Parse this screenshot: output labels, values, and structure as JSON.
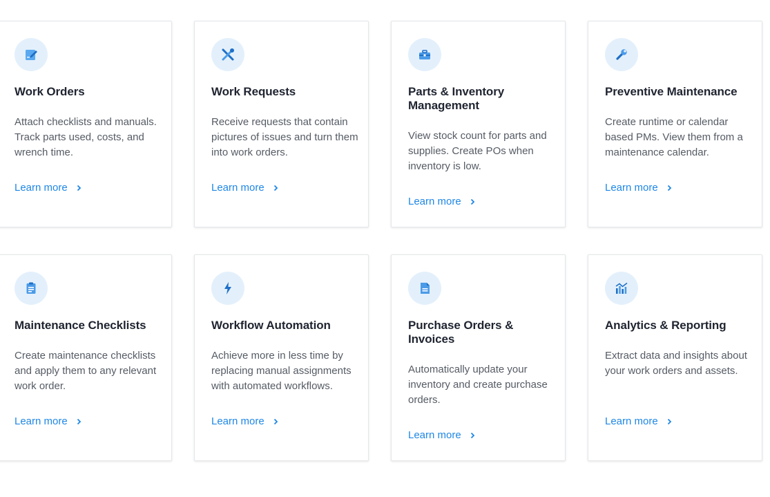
{
  "accent_color": "#1e87e6",
  "icon_bg_color": "#e3f0fc",
  "cards": [
    {
      "title": "Work Orders",
      "icon": "work-order-edit-icon",
      "description": "Attach checklists and manuals. Track parts used, costs, and wrench time.",
      "link": "Learn more"
    },
    {
      "title": "Work Requests",
      "icon": "tools-icon",
      "description": "Receive requests that contain pictures of issues and turn them into work orders.",
      "link": "Learn more"
    },
    {
      "title": "Parts & Inventory Management",
      "icon": "toolbox-icon",
      "description": "View stock count for parts and supplies. Create POs when inventory is low.",
      "link": "Learn more"
    },
    {
      "title": "Preventive Maintenance",
      "icon": "wrench-icon",
      "description": "Create runtime or calendar based PMs. View them from a maintenance calendar.",
      "link": "Learn more"
    },
    {
      "title": "Maintenance Checklists",
      "icon": "clipboard-icon",
      "description": "Create maintenance checklists and apply them to any relevant work order.",
      "link": "Learn more"
    },
    {
      "title": "Workflow Automation",
      "icon": "lightning-icon",
      "description": "Achieve more in less time by replacing manual assignments with automated workflows.",
      "link": "Learn more"
    },
    {
      "title": "Purchase Orders & Invoices",
      "icon": "document-icon",
      "description": "Automatically update your inventory and create purchase orders.",
      "link": "Learn more"
    },
    {
      "title": "Analytics & Reporting",
      "icon": "analytics-chart-icon",
      "description": "Extract data and insights about your work orders and assets.",
      "link": "Learn more"
    }
  ]
}
